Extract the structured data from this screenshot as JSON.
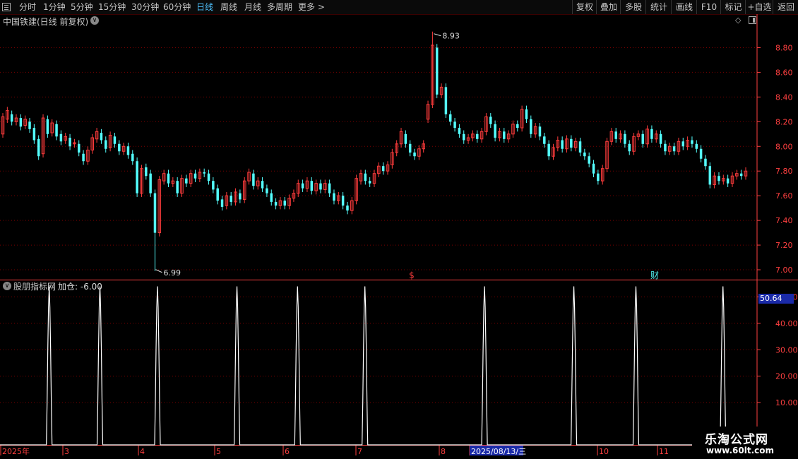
{
  "toolbar": {
    "periods": [
      "分时",
      "1分钟",
      "5分钟",
      "15分钟",
      "30分钟",
      "60分钟",
      "日线",
      "周线",
      "月线",
      "多周期",
      "更多 >"
    ],
    "active": "日线",
    "right_buttons": [
      "复权",
      "叠加",
      "多股",
      "统计",
      "画线",
      "F10",
      "标记",
      "+自选",
      "返回"
    ]
  },
  "main_title": "中国铁建(日线 前复权)",
  "sub_title": "股朋指标网",
  "sub_value_label": "加仓: -6.00",
  "current_value": "50.64",
  "annotations": {
    "high": "8.93",
    "low": "6.99",
    "s_marker": "$",
    "cai_marker": "财"
  },
  "watermark": {
    "line1": "乐淘公式网",
    "line2": "www.60lt.com"
  },
  "colors": {
    "up": "#ff3c3c",
    "down": "#54ffff",
    "grid": "#7a0000",
    "axis": "#ff4040",
    "active_tab": "#4fc3ff",
    "line": "#ffffff"
  },
  "date_axis": {
    "labels": [
      "2025年",
      "3",
      "4",
      "5",
      "6",
      "7",
      "8",
      "2025/08/13/三",
      "10",
      "11"
    ]
  },
  "chart_data": [
    {
      "type": "candlestick",
      "title": "中国铁建(日线 前复权)",
      "y_ticks": [
        7.0,
        7.2,
        7.4,
        7.6,
        7.8,
        8.0,
        8.2,
        8.4,
        8.6,
        8.8
      ],
      "ylim": [
        6.92,
        8.98
      ],
      "high": 8.93,
      "low": 6.99,
      "grid": true,
      "candles": [
        [
          8.1,
          8.24
        ],
        [
          8.22,
          8.29
        ],
        [
          8.26,
          8.2
        ],
        [
          8.2,
          8.23
        ],
        [
          8.23,
          8.16
        ],
        [
          8.17,
          8.22
        ],
        [
          8.2,
          8.14
        ],
        [
          8.15,
          8.05
        ],
        [
          8.06,
          7.92
        ],
        [
          7.94,
          8.23
        ],
        [
          8.22,
          8.1
        ],
        [
          8.11,
          8.19
        ],
        [
          8.18,
          8.08
        ],
        [
          8.1,
          8.04
        ],
        [
          8.05,
          8.08
        ],
        [
          8.07,
          8.0
        ],
        [
          8.02,
          8.03
        ],
        [
          8.02,
          7.95
        ],
        [
          7.94,
          7.88
        ],
        [
          7.88,
          7.97
        ],
        [
          7.97,
          8.07
        ],
        [
          8.06,
          8.12
        ],
        [
          8.11,
          8.05
        ],
        [
          8.05,
          7.98
        ],
        [
          7.99,
          8.09
        ],
        [
          8.08,
          8.02
        ],
        [
          8.02,
          7.96
        ],
        [
          7.96,
          8.0
        ],
        [
          8.0,
          7.93
        ],
        [
          7.94,
          7.88
        ],
        [
          7.88,
          7.62
        ],
        [
          7.62,
          7.82
        ],
        [
          7.83,
          7.76
        ],
        [
          7.78,
          7.62
        ],
        [
          7.62,
          7.3
        ],
        [
          7.3,
          7.73
        ],
        [
          7.72,
          7.78
        ],
        [
          7.78,
          7.7
        ],
        [
          7.7,
          7.72
        ],
        [
          7.72,
          7.62
        ],
        [
          7.62,
          7.74
        ],
        [
          7.74,
          7.7
        ],
        [
          7.7,
          7.78
        ],
        [
          7.78,
          7.74
        ],
        [
          7.74,
          7.79
        ],
        [
          7.79,
          7.78
        ],
        [
          7.78,
          7.72
        ],
        [
          7.72,
          7.65
        ],
        [
          7.66,
          7.56
        ],
        [
          7.57,
          7.51
        ],
        [
          7.52,
          7.6
        ],
        [
          7.6,
          7.55
        ],
        [
          7.55,
          7.63
        ],
        [
          7.62,
          7.57
        ],
        [
          7.57,
          7.72
        ],
        [
          7.72,
          7.79
        ],
        [
          7.78,
          7.68
        ],
        [
          7.68,
          7.72
        ],
        [
          7.72,
          7.66
        ],
        [
          7.66,
          7.62
        ],
        [
          7.62,
          7.55
        ],
        [
          7.55,
          7.52
        ],
        [
          7.52,
          7.56
        ],
        [
          7.56,
          7.52
        ],
        [
          7.52,
          7.58
        ],
        [
          7.58,
          7.62
        ],
        [
          7.62,
          7.7
        ],
        [
          7.7,
          7.66
        ],
        [
          7.66,
          7.72
        ],
        [
          7.72,
          7.64
        ],
        [
          7.64,
          7.7
        ],
        [
          7.7,
          7.65
        ],
        [
          7.65,
          7.7
        ],
        [
          7.7,
          7.62
        ],
        [
          7.62,
          7.56
        ],
        [
          7.56,
          7.6
        ],
        [
          7.6,
          7.52
        ],
        [
          7.52,
          7.48
        ],
        [
          7.48,
          7.56
        ],
        [
          7.56,
          7.74
        ],
        [
          7.72,
          7.78
        ],
        [
          7.78,
          7.72
        ],
        [
          7.72,
          7.7
        ],
        [
          7.7,
          7.78
        ],
        [
          7.78,
          7.84
        ],
        [
          7.84,
          7.8
        ],
        [
          7.8,
          7.85
        ],
        [
          7.85,
          7.95
        ],
        [
          7.95,
          8.02
        ],
        [
          8.02,
          8.12
        ],
        [
          8.1,
          8.02
        ],
        [
          8.02,
          7.95
        ],
        [
          7.95,
          7.92
        ],
        [
          7.92,
          7.98
        ],
        [
          7.98,
          8.02
        ],
        [
          8.22,
          8.34
        ],
        [
          8.34,
          8.82
        ],
        [
          8.8,
          8.42
        ],
        [
          8.42,
          8.48
        ],
        [
          8.48,
          8.26
        ],
        [
          8.26,
          8.2
        ],
        [
          8.2,
          8.15
        ],
        [
          8.15,
          8.1
        ],
        [
          8.1,
          8.05
        ],
        [
          8.05,
          8.07
        ],
        [
          8.07,
          8.1
        ],
        [
          8.1,
          8.06
        ],
        [
          8.06,
          8.12
        ],
        [
          8.12,
          8.24
        ],
        [
          8.24,
          8.18
        ],
        [
          8.18,
          8.07
        ],
        [
          8.07,
          8.12
        ],
        [
          8.12,
          8.06
        ],
        [
          8.06,
          8.1
        ],
        [
          8.1,
          8.18
        ],
        [
          8.18,
          8.15
        ],
        [
          8.15,
          8.3
        ],
        [
          8.3,
          8.22
        ],
        [
          8.22,
          8.1
        ],
        [
          8.1,
          8.16
        ],
        [
          8.16,
          8.08
        ],
        [
          8.08,
          8.02
        ],
        [
          8.02,
          7.92
        ],
        [
          7.92,
          7.99
        ],
        [
          7.99,
          8.05
        ],
        [
          8.05,
          7.98
        ],
        [
          7.98,
          8.06
        ],
        [
          8.06,
          7.99
        ],
        [
          7.99,
          8.04
        ],
        [
          8.04,
          7.95
        ],
        [
          7.95,
          7.92
        ],
        [
          7.92,
          7.86
        ],
        [
          7.86,
          7.78
        ],
        [
          7.78,
          7.72
        ],
        [
          7.72,
          7.82
        ],
        [
          7.82,
          8.04
        ],
        [
          8.04,
          8.12
        ],
        [
          8.12,
          8.06
        ],
        [
          8.06,
          8.1
        ],
        [
          8.1,
          8.02
        ],
        [
          8.02,
          7.96
        ],
        [
          7.96,
          8.08
        ],
        [
          8.08,
          8.1
        ],
        [
          8.1,
          8.02
        ],
        [
          8.02,
          8.14
        ],
        [
          8.14,
          8.06
        ],
        [
          8.06,
          8.1
        ],
        [
          8.1,
          8.02
        ],
        [
          8.02,
          7.96
        ],
        [
          7.96,
          8.0
        ],
        [
          8.0,
          7.96
        ],
        [
          7.96,
          8.04
        ],
        [
          8.04,
          8.0
        ],
        [
          8.0,
          8.05
        ],
        [
          8.05,
          8.02
        ],
        [
          8.02,
          7.98
        ],
        [
          7.98,
          7.9
        ],
        [
          7.9,
          7.84
        ],
        [
          7.84,
          7.69
        ],
        [
          7.69,
          7.76
        ],
        [
          7.76,
          7.72
        ],
        [
          7.72,
          7.74
        ],
        [
          7.74,
          7.7
        ],
        [
          7.7,
          7.76
        ],
        [
          7.76,
          7.78
        ],
        [
          7.78,
          7.76
        ],
        [
          7.76,
          7.8
        ]
      ]
    },
    {
      "type": "line",
      "title": "股朋指标网",
      "series": [
        {
          "name": "加仓",
          "value": -6.0
        }
      ],
      "current": 50.64,
      "y_ticks": [
        10.0,
        20.0,
        30.0,
        40.0,
        50.0
      ],
      "ylim": [
        -6,
        56
      ],
      "baseline": -6,
      "peak": 54,
      "spike_positions": [
        0.065,
        0.132,
        0.208,
        0.313,
        0.393,
        0.482,
        0.64,
        0.758,
        0.84,
        0.955,
        1.015
      ]
    }
  ]
}
